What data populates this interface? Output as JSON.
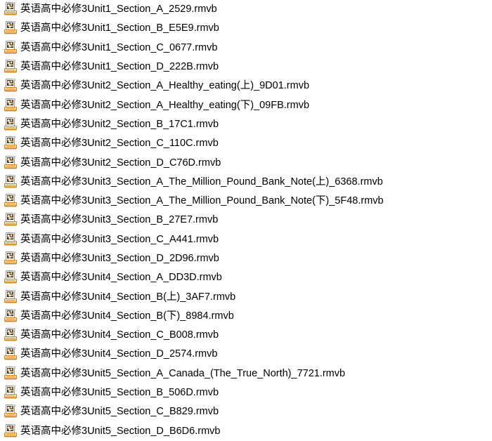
{
  "window": {
    "view_mode": "list",
    "background_color": "#ffffff",
    "text_color": "#000000"
  },
  "icon": {
    "semantic_name": "rmvb-video-file-icon",
    "description": "document sheet with picture thumbnail on orange tray",
    "sheet_color": "#fdfdfd",
    "accent_color": "#e8a93c",
    "border_color": "#d2841b"
  },
  "files": [
    {
      "name": "英语高中必修3Unit1_Section_A_2529.rmvb",
      "extension": "rmvb"
    },
    {
      "name": "英语高中必修3Unit1_Section_B_E5E9.rmvb",
      "extension": "rmvb"
    },
    {
      "name": "英语高中必修3Unit1_Section_C_0677.rmvb",
      "extension": "rmvb"
    },
    {
      "name": "英语高中必修3Unit1_Section_D_222B.rmvb",
      "extension": "rmvb"
    },
    {
      "name": "英语高中必修3Unit2_Section_A_Healthy_eating(上)_9D01.rmvb",
      "extension": "rmvb"
    },
    {
      "name": "英语高中必修3Unit2_Section_A_Healthy_eating(下)_09FB.rmvb",
      "extension": "rmvb"
    },
    {
      "name": "英语高中必修3Unit2_Section_B_17C1.rmvb",
      "extension": "rmvb"
    },
    {
      "name": "英语高中必修3Unit2_Section_C_110C.rmvb",
      "extension": "rmvb"
    },
    {
      "name": "英语高中必修3Unit2_Section_D_C76D.rmvb",
      "extension": "rmvb"
    },
    {
      "name": "英语高中必修3Unit3_Section_A_The_Million_Pound_Bank_Note(上)_6368.rmvb",
      "extension": "rmvb"
    },
    {
      "name": "英语高中必修3Unit3_Section_A_The_Million_Pound_Bank_Note(下)_5F48.rmvb",
      "extension": "rmvb"
    },
    {
      "name": "英语高中必修3Unit3_Section_B_27E7.rmvb",
      "extension": "rmvb"
    },
    {
      "name": "英语高中必修3Unit3_Section_C_A441.rmvb",
      "extension": "rmvb"
    },
    {
      "name": "英语高中必修3Unit3_Section_D_2D96.rmvb",
      "extension": "rmvb"
    },
    {
      "name": "英语高中必修3Unit4_Section_A_DD3D.rmvb",
      "extension": "rmvb"
    },
    {
      "name": "英语高中必修3Unit4_Section_B(上)_3AF7.rmvb",
      "extension": "rmvb"
    },
    {
      "name": "英语高中必修3Unit4_Section_B(下)_8984.rmvb",
      "extension": "rmvb"
    },
    {
      "name": "英语高中必修3Unit4_Section_C_B008.rmvb",
      "extension": "rmvb"
    },
    {
      "name": "英语高中必修3Unit4_Section_D_2574.rmvb",
      "extension": "rmvb"
    },
    {
      "name": "英语高中必修3Unit5_Section_A_Canada_(The_True_North)_7721.rmvb",
      "extension": "rmvb"
    },
    {
      "name": "英语高中必修3Unit5_Section_B_506D.rmvb",
      "extension": "rmvb"
    },
    {
      "name": "英语高中必修3Unit5_Section_C_B829.rmvb",
      "extension": "rmvb"
    },
    {
      "name": "英语高中必修3Unit5_Section_D_B6D6.rmvb",
      "extension": "rmvb"
    }
  ]
}
